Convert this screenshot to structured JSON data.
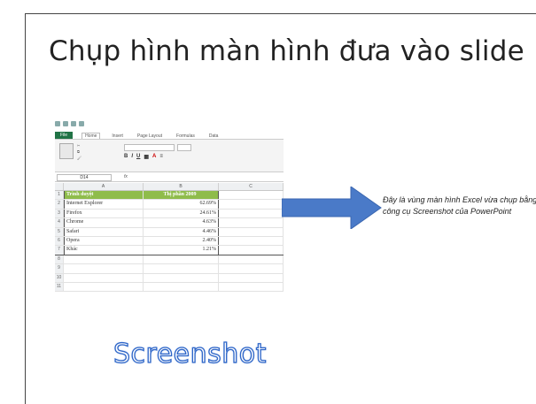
{
  "slide": {
    "title": "Chụp hình màn hình đưa vào slide",
    "note": "Đây là vùng màn hình Excel vừa chụp bằng công cụ Screenshot của PowerPoint",
    "wordart": "Screenshot"
  },
  "excel": {
    "tabs": [
      "File",
      "Home",
      "Insert",
      "Page Layout",
      "Formulas",
      "Data"
    ],
    "name_box": "D14",
    "formula_symbol": "fx",
    "columns": [
      "A",
      "B",
      "C"
    ],
    "table_header": {
      "a": "Trình duyệt",
      "b": "Thị phần 2009"
    },
    "rows": [
      {
        "num": "1",
        "a": "Trình duyệt",
        "b": "Thị phần 2009"
      },
      {
        "num": "2",
        "a": "Internet Explorer",
        "b": "62.69%"
      },
      {
        "num": "3",
        "a": "Firefox",
        "b": "24.61%"
      },
      {
        "num": "4",
        "a": "Chrome",
        "b": "4.63%"
      },
      {
        "num": "5",
        "a": "Safari",
        "b": "4.46%"
      },
      {
        "num": "6",
        "a": "Opera",
        "b": "2.40%"
      },
      {
        "num": "7",
        "a": "Khác",
        "b": "1.21%"
      },
      {
        "num": "8",
        "a": "",
        "b": ""
      },
      {
        "num": "9",
        "a": "",
        "b": ""
      },
      {
        "num": "10",
        "a": "",
        "b": ""
      },
      {
        "num": "11",
        "a": "",
        "b": ""
      }
    ]
  },
  "colors": {
    "arrow": "#4a7ac8",
    "header_green": "#8fbc4b",
    "wordart_outline": "#2e66c8"
  }
}
